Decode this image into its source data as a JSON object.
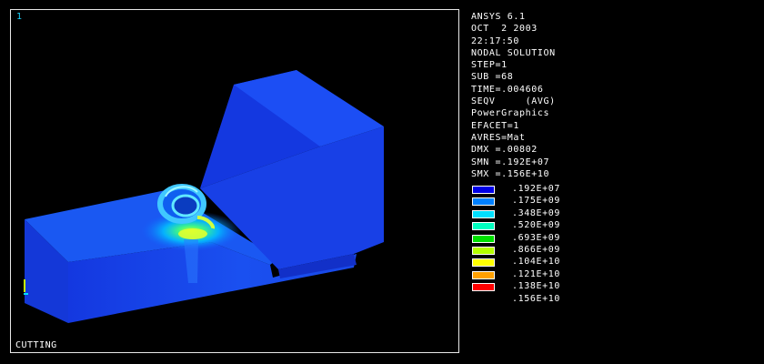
{
  "viewport": {
    "window_number": "1",
    "title": "CUTTING"
  },
  "info": {
    "lines": [
      "ANSYS 6.1",
      "OCT  2 2003",
      "22:17:50",
      "NODAL SOLUTION",
      "STEP=1",
      "SUB =68",
      "TIME=.004606",
      "SEQV     (AVG)",
      "PowerGraphics",
      "EFACET=1",
      "AVRES=Mat",
      "DMX =.00802",
      "SMN =.192E+07",
      "SMX =.156E+10"
    ]
  },
  "legend": {
    "entries": [
      {
        "value": ".192E+07",
        "color": "#0000e6"
      },
      {
        "value": ".175E+09",
        "color": "#0080ff"
      },
      {
        "value": ".348E+09",
        "color": "#00e0ff"
      },
      {
        "value": ".520E+09",
        "color": "#00ffc0"
      },
      {
        "value": ".693E+09",
        "color": "#00e000"
      },
      {
        "value": ".866E+09",
        "color": "#b4ff00"
      },
      {
        "value": ".104E+10",
        "color": "#ffff00"
      },
      {
        "value": ".121E+10",
        "color": "#ffa000"
      },
      {
        "value": ".138E+10",
        "color": "#ff0000"
      },
      {
        "value": ".156E+10",
        "color": null
      }
    ]
  },
  "colors": {
    "background": "#000000",
    "frame": "#e8e8e8",
    "window_number": "#1ad6ff",
    "text": "#ffffff"
  }
}
